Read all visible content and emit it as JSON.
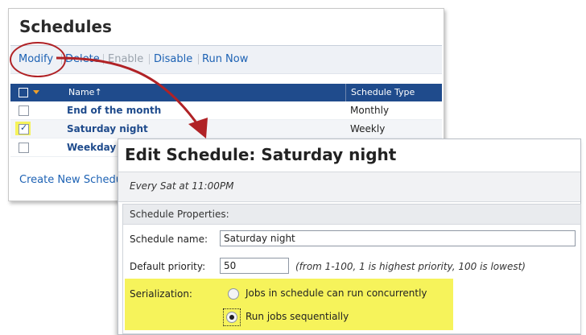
{
  "schedules": {
    "title": "Schedules",
    "toolbar": [
      {
        "label": "Modify",
        "enabled": true
      },
      {
        "label": "Delete",
        "enabled": true
      },
      {
        "label": "Enable",
        "enabled": false
      },
      {
        "label": "Disable",
        "enabled": true
      },
      {
        "label": "Run Now",
        "enabled": true
      }
    ],
    "columns": {
      "name": "Name↑",
      "type": "Schedule Type"
    },
    "rows": [
      {
        "name": "End of the month",
        "type": "Monthly",
        "checked": false
      },
      {
        "name": "Saturday night",
        "type": "Weekly",
        "checked": true
      },
      {
        "name": "Weekday",
        "type": "",
        "checked": false
      }
    ],
    "create_link": "Create New Schedu"
  },
  "edit": {
    "title": "Edit Schedule: Saturday night",
    "summary": "Every Sat at 11:00PM",
    "section_title": "Schedule Properties:",
    "name_label": "Schedule name:",
    "name_value": "Saturday night",
    "priority_label": "Default priority:",
    "priority_value": "50",
    "priority_hint": "(from 1-100, 1 is highest priority, 100 is lowest)",
    "serialization_label": "Serialization:",
    "options": [
      {
        "label": "Jobs in schedule can run concurrently",
        "selected": false
      },
      {
        "label": "Run jobs sequentially",
        "selected": true
      }
    ]
  },
  "colors": {
    "accent": "#1f4b8c",
    "link": "#1d62b4",
    "highlight": "#f6f35b",
    "annotation": "#b02226"
  }
}
